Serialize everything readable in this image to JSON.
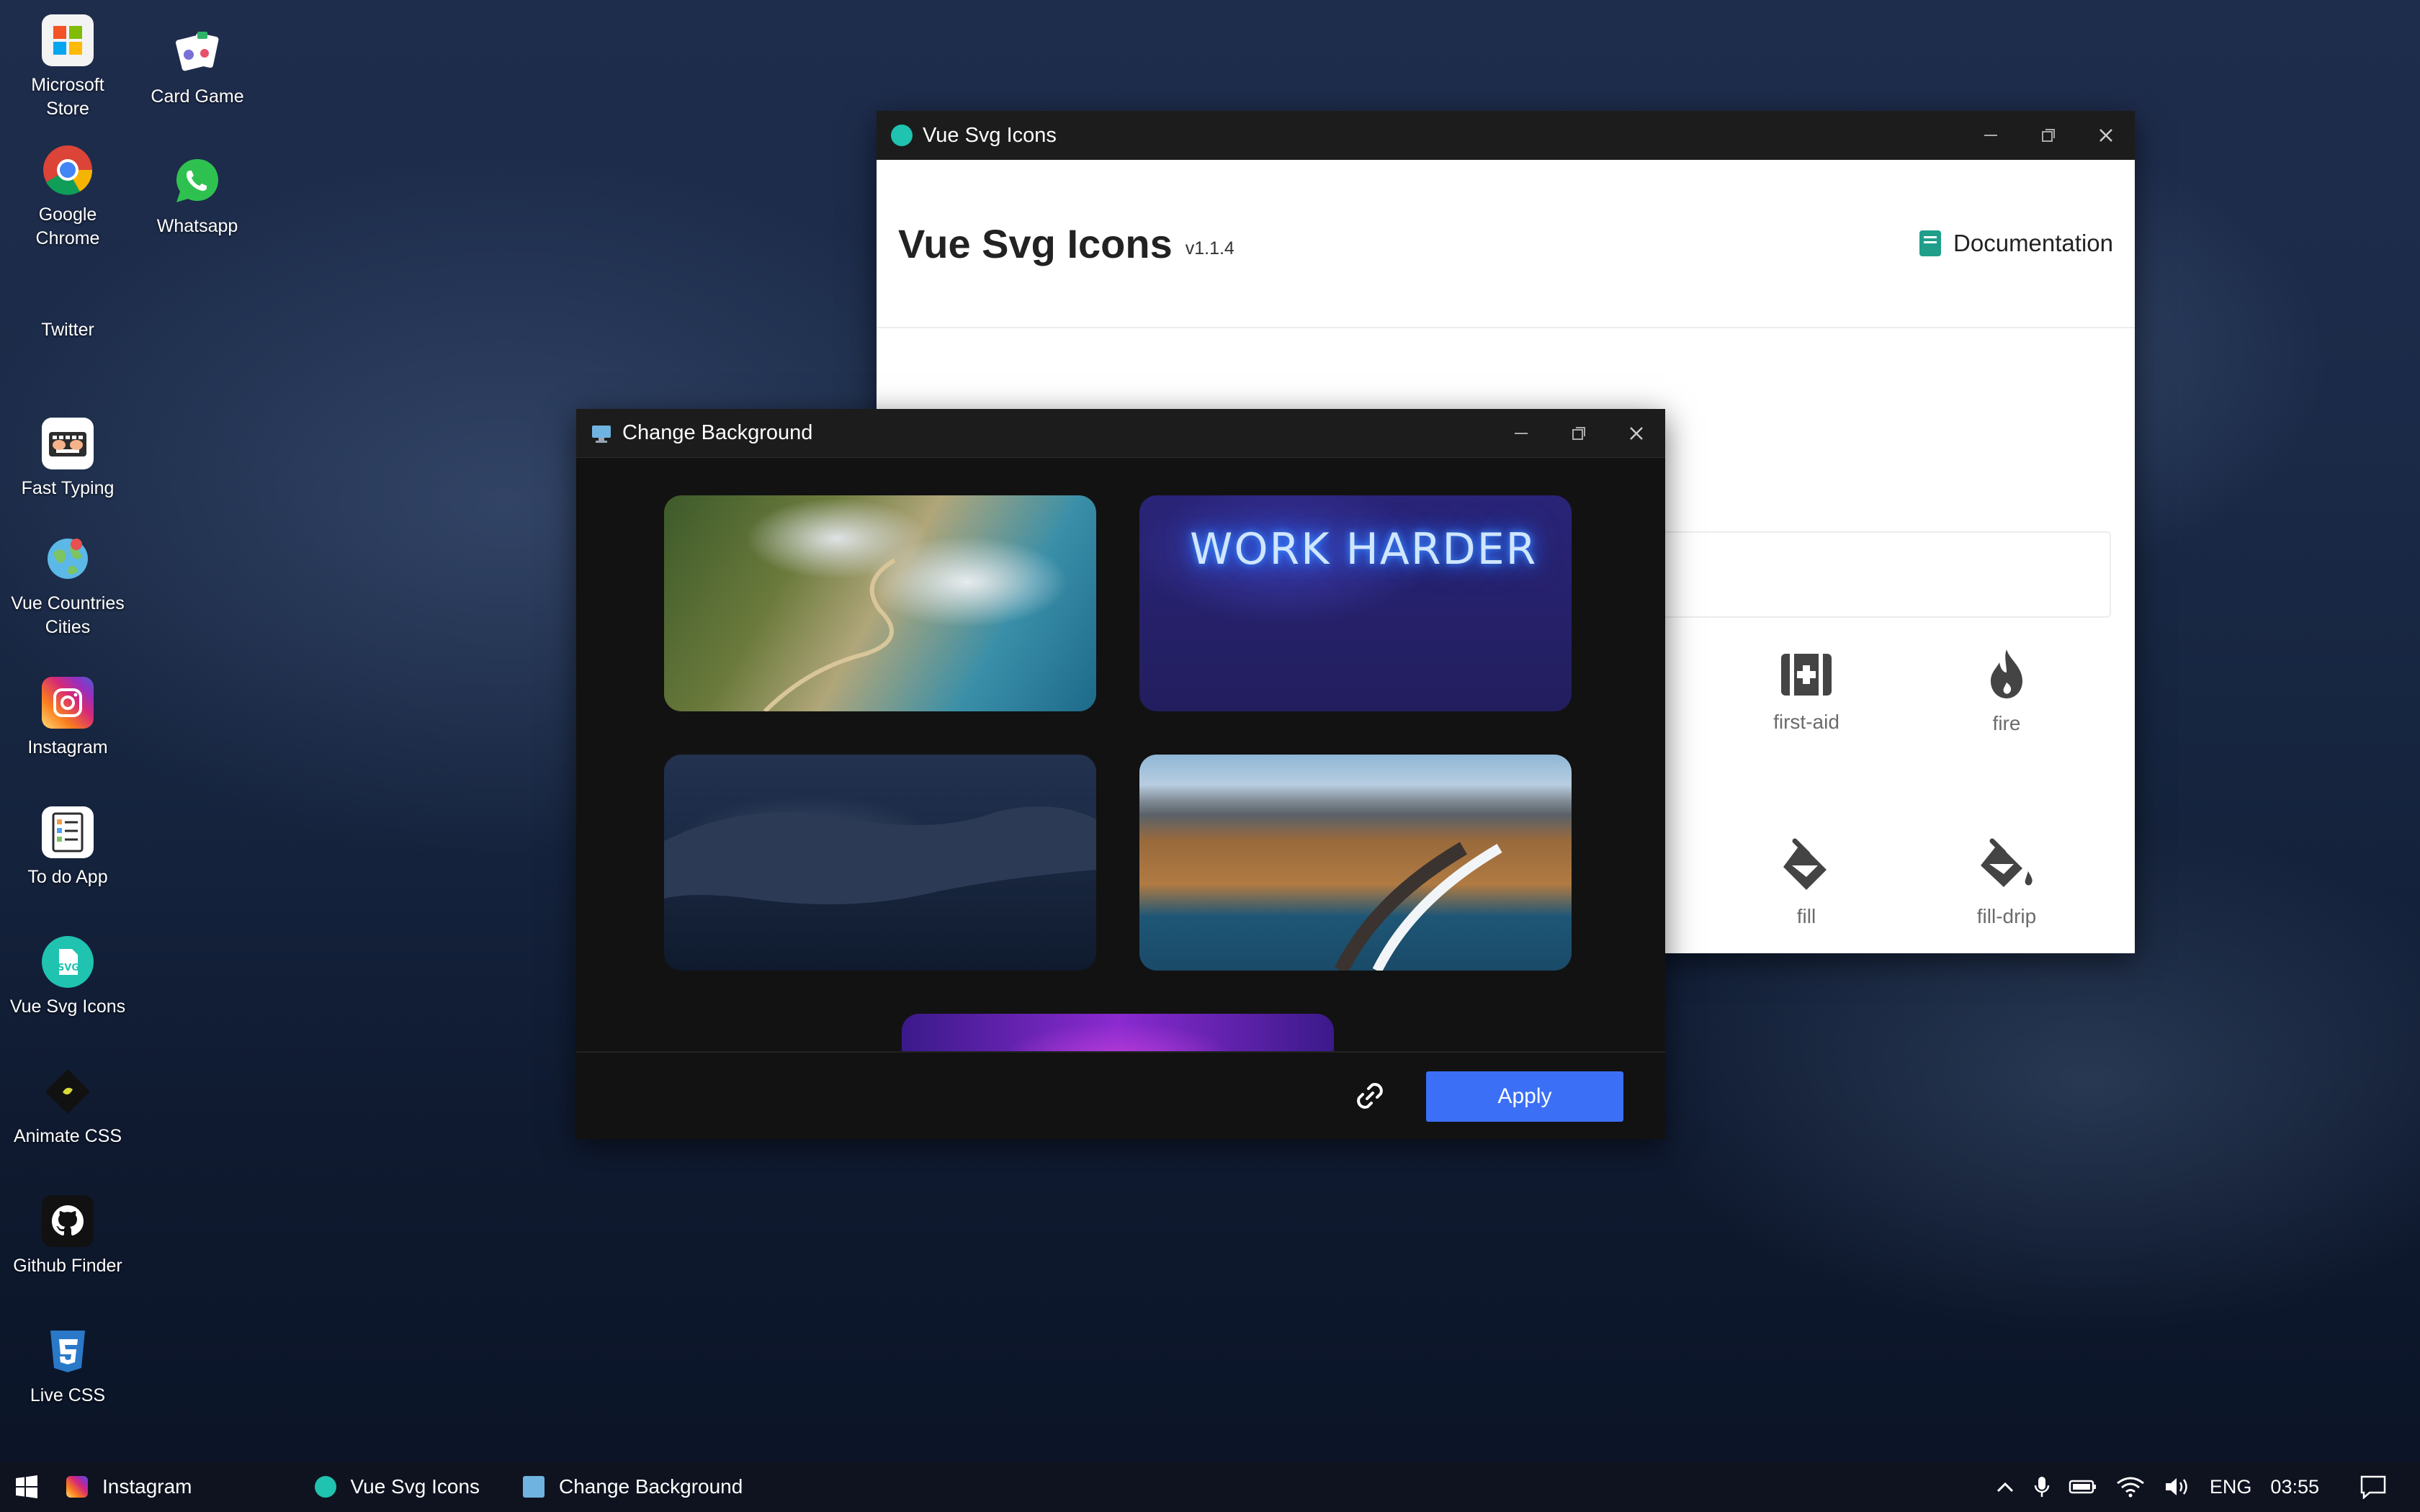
{
  "desktop": {
    "icons": [
      {
        "label_line1": "Microsoft",
        "label_line2": "Store",
        "icon": "microsoft-store-icon"
      },
      {
        "label_line1": "Google",
        "label_line2": "Chrome",
        "icon": "chrome-icon"
      },
      {
        "label_line1": "Twitter",
        "label_line2": "",
        "icon": "twitter-icon"
      },
      {
        "label_line1": "Fast Typing",
        "label_line2": "",
        "icon": "keyboard-hands-icon"
      },
      {
        "label_line1": "Vue Countries",
        "label_line2": "Cities",
        "icon": "globe-icon"
      },
      {
        "label_line1": "Instagram",
        "label_line2": "",
        "icon": "instagram-icon"
      },
      {
        "label_line1": "To do App",
        "label_line2": "",
        "icon": "todo-list-icon"
      },
      {
        "label_line1": "Vue Svg Icons",
        "label_line2": "",
        "icon": "svg-file-icon"
      },
      {
        "label_line1": "Animate CSS",
        "label_line2": "",
        "icon": "animate-css-icon"
      },
      {
        "label_line1": "Github Finder",
        "label_line2": "",
        "icon": "github-icon"
      },
      {
        "label_line1": "Live CSS",
        "label_line2": "",
        "icon": "css3-icon"
      },
      {
        "label_line1": "Card Game",
        "label_line2": "",
        "icon": "card-game-icon"
      },
      {
        "label_line1": "Whatsapp",
        "label_line2": "",
        "icon": "whatsapp-icon"
      }
    ]
  },
  "vue_window": {
    "title": "Vue Svg Icons",
    "brand": "Vue Svg Icons",
    "version": "v1.1.4",
    "doc_link": "Documentation",
    "icons": [
      {
        "name": "first-aid"
      },
      {
        "name": "fire"
      },
      {
        "name": "fill"
      },
      {
        "name": "fill-drip"
      }
    ]
  },
  "bg_window": {
    "title": "Change Background",
    "wallpapers": [
      {
        "name": "coastal-road-clouds"
      },
      {
        "name": "work-harder-neon",
        "text": "WORK HARDER"
      },
      {
        "name": "dark-coastline"
      },
      {
        "name": "black-sand-beach"
      },
      {
        "name": "purple-gradient"
      }
    ],
    "apply_label": "Apply"
  },
  "taskbar": {
    "items": [
      {
        "label": "Instagram"
      },
      {
        "label": "Vue Svg Icons"
      },
      {
        "label": "Change Background"
      }
    ],
    "language": "ENG",
    "time": "03:55"
  },
  "colors": {
    "accent": "#3b6ff5",
    "doc_icon": "#1f9e8a",
    "titlebar": "#1c1c1c"
  }
}
